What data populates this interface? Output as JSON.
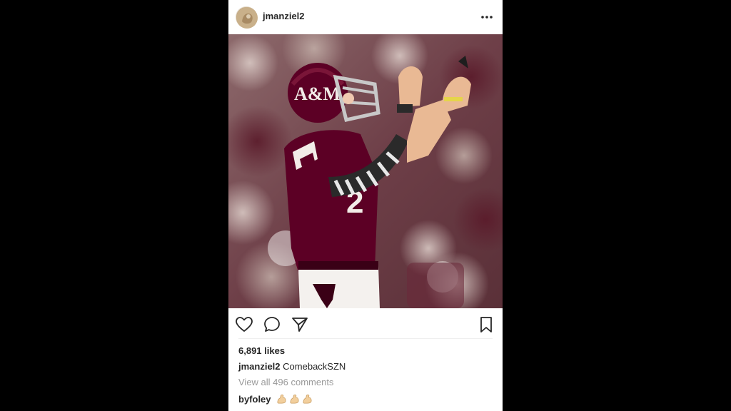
{
  "post": {
    "username": "jmanziel2",
    "likes": "6,891 likes",
    "caption_user": "jmanziel2",
    "caption_text": "ComebackSZN",
    "view_comments": "View all 496 comments",
    "comment_user": "byfoley",
    "comment_emoji_count": 3
  },
  "icons": {
    "more": "more-options-icon",
    "like": "heart-icon",
    "comment": "comment-bubble-icon",
    "share": "paper-plane-icon",
    "save": "bookmark-icon",
    "emoji": "flexed-biceps-icon"
  },
  "colors": {
    "maroon": "#5c0025",
    "text": "#262626",
    "muted": "#999999",
    "background": "#000000"
  }
}
